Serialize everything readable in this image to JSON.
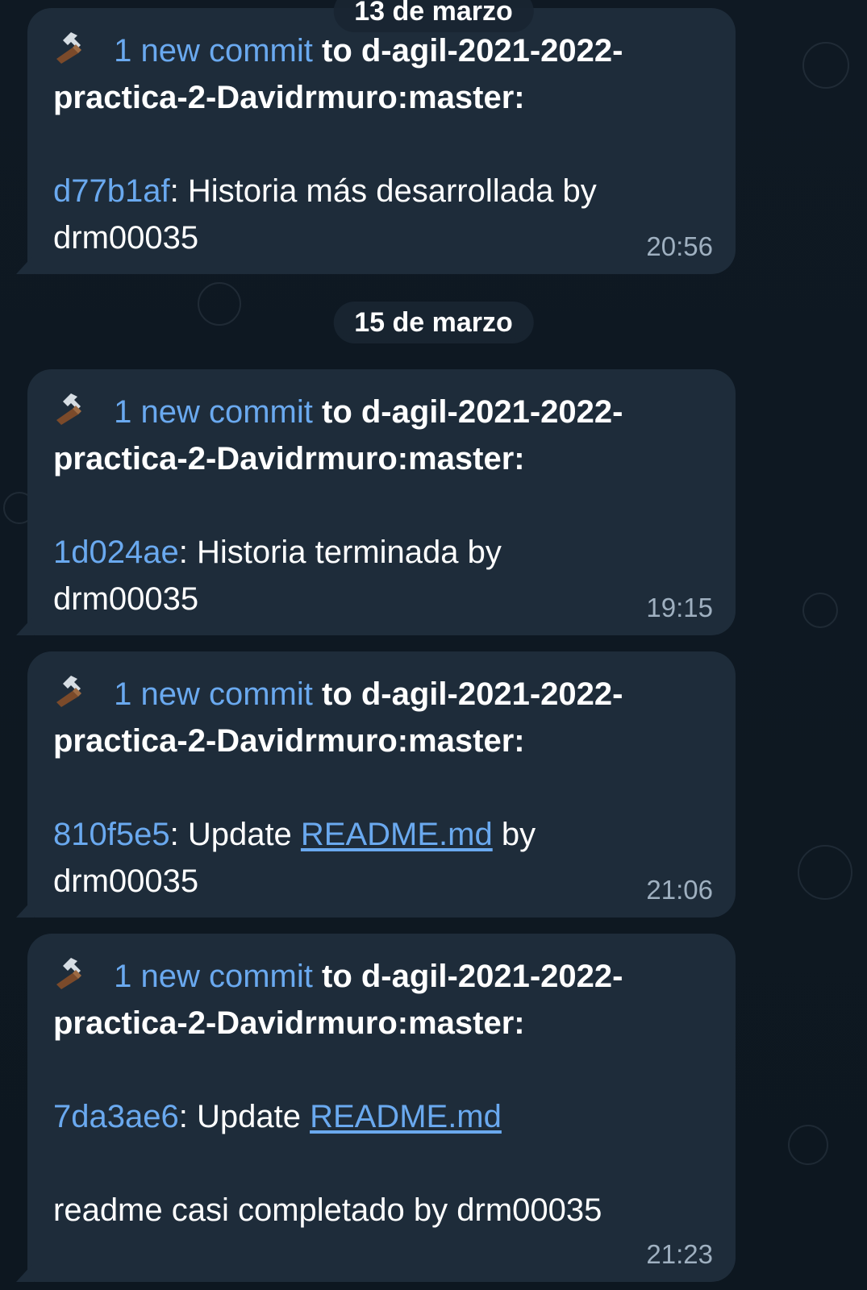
{
  "dates": [
    "13 de marzo",
    "15 de marzo"
  ],
  "messages": [
    {
      "icon": "hammer-icon",
      "prefix": "1 new commit",
      "target_line_1": "to d-agil-2021-2022-",
      "target_line_2": "practica-2-Davidrmuro:master:",
      "hash": "d77b1af",
      "body_line_1": ": Historia más desarrollada by",
      "body_line_2": "drm00035",
      "time": "20:56"
    },
    {
      "icon": "hammer-icon",
      "prefix": "1 new commit",
      "target_line_1": "to d-agil-2021-2022-",
      "target_line_2": "practica-2-Davidrmuro:master:",
      "hash": "1d024ae",
      "body_line_1": ": Historia terminada by",
      "body_line_2": "drm00035",
      "time": "19:15"
    },
    {
      "icon": "hammer-icon",
      "prefix": "1 new commit",
      "target_line_1": "to d-agil-2021-2022-",
      "target_line_2": "practica-2-Davidrmuro:master:",
      "hash": "810f5e5",
      "body_pre_link": ": Update ",
      "link_text": "README.md",
      "body_post_link": " by",
      "body_line_2": "drm00035",
      "time": "21:06"
    },
    {
      "icon": "hammer-icon",
      "prefix": "1 new commit",
      "target_line_1": "to d-agil-2021-2022-",
      "target_line_2": "practica-2-Davidrmuro:master:",
      "hash": "7da3ae6",
      "body_pre_link": ": Update ",
      "link_text": "README.md",
      "body_line_3": "readme casi completado by drm00035",
      "time": "21:23"
    }
  ]
}
